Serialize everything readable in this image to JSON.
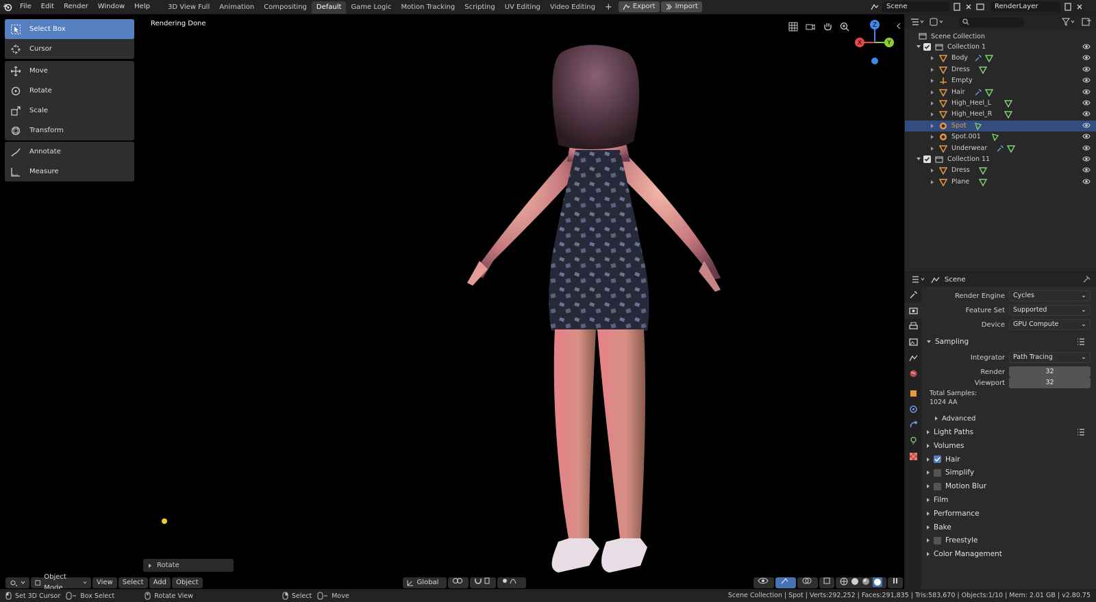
{
  "topbar": {
    "menus": [
      "File",
      "Edit",
      "Render",
      "Window",
      "Help"
    ],
    "workspaces": [
      "3D View Full",
      "Animation",
      "Compositing",
      "Default",
      "Game Logic",
      "Motion Tracking",
      "Scripting",
      "UV Editing",
      "Video Editing"
    ],
    "active_workspace": "Default",
    "add_label": "+",
    "export_label": "Export",
    "import_label": "Import",
    "scene_name": "Scene",
    "view_layer": "RenderLayer"
  },
  "viewport": {
    "status_text": "Rendering Done",
    "tools": {
      "group1": [
        "Select Box",
        "Cursor"
      ],
      "group2": [
        "Move",
        "Rotate",
        "Scale",
        "Transform"
      ],
      "group3": [
        "Annotate",
        "Measure"
      ]
    },
    "last_operator": "Rotate",
    "axes": {
      "x": "X",
      "y": "Y",
      "z": "Z"
    },
    "header": {
      "mode": "Object Mode",
      "menus": [
        "View",
        "Select",
        "Add",
        "Object"
      ],
      "orientation": "Global"
    }
  },
  "outliner": {
    "root": "Scene Collection",
    "rows": [
      {
        "label": "Collection 1",
        "kind": "collection"
      },
      {
        "label": "Body",
        "kind": "mesh"
      },
      {
        "label": "Dress",
        "kind": "mesh"
      },
      {
        "label": "Empty",
        "kind": "empty"
      },
      {
        "label": "Hair",
        "kind": "mesh"
      },
      {
        "label": "High_Heel_L",
        "kind": "mesh"
      },
      {
        "label": "High_Heel_R",
        "kind": "mesh"
      },
      {
        "label": "Spot",
        "kind": "light",
        "selected": true
      },
      {
        "label": "Spot.001",
        "kind": "light"
      },
      {
        "label": "Underwear",
        "kind": "mesh"
      },
      {
        "label": "Collection 11",
        "kind": "collection"
      },
      {
        "label": "Dress",
        "kind": "mesh"
      },
      {
        "label": "Plane",
        "kind": "mesh"
      }
    ]
  },
  "properties": {
    "context": "Scene",
    "render_engine_label": "Render Engine",
    "render_engine": "Cycles",
    "feature_set_label": "Feature Set",
    "feature_set": "Supported",
    "device_label": "Device",
    "device": "GPU Compute",
    "sampling": {
      "title": "Sampling",
      "integrator_label": "Integrator",
      "integrator": "Path Tracing",
      "render_label": "Render",
      "render": "32",
      "viewport_label": "Viewport",
      "viewport": "32",
      "total_label": "Total Samples:",
      "total_value": "1024 AA",
      "advanced": "Advanced"
    },
    "panels": [
      {
        "label": "Light Paths",
        "checkbox": null
      },
      {
        "label": "Volumes",
        "checkbox": null
      },
      {
        "label": "Hair",
        "checkbox": true
      },
      {
        "label": "Simplify",
        "checkbox": false
      },
      {
        "label": "Motion Blur",
        "checkbox": false
      },
      {
        "label": "Film",
        "checkbox": null
      },
      {
        "label": "Performance",
        "checkbox": null
      },
      {
        "label": "Bake",
        "checkbox": null
      },
      {
        "label": "Freestyle",
        "checkbox": false
      },
      {
        "label": "Color Management",
        "checkbox": null
      }
    ]
  },
  "statusbar": {
    "items": [
      "Set 3D Cursor",
      "Box Select",
      "Rotate View",
      "Select",
      "Move"
    ],
    "info": "Scene Collection | Spot | Verts:292,252 | Faces:291,835 | Tris:583,670 | Objects:1/10 | Mem: 2.01 GB | v2.80.75"
  },
  "colors": {
    "accent": "#5680c2",
    "selection": "#334d80",
    "mesh_icon": "#e89b3c",
    "modifier_icon": "#6e9cdf",
    "data_icon": "#7dd36b",
    "x_axis": "#e5484d",
    "y_axis": "#8fcd37",
    "z_axis": "#3e8aeb"
  }
}
